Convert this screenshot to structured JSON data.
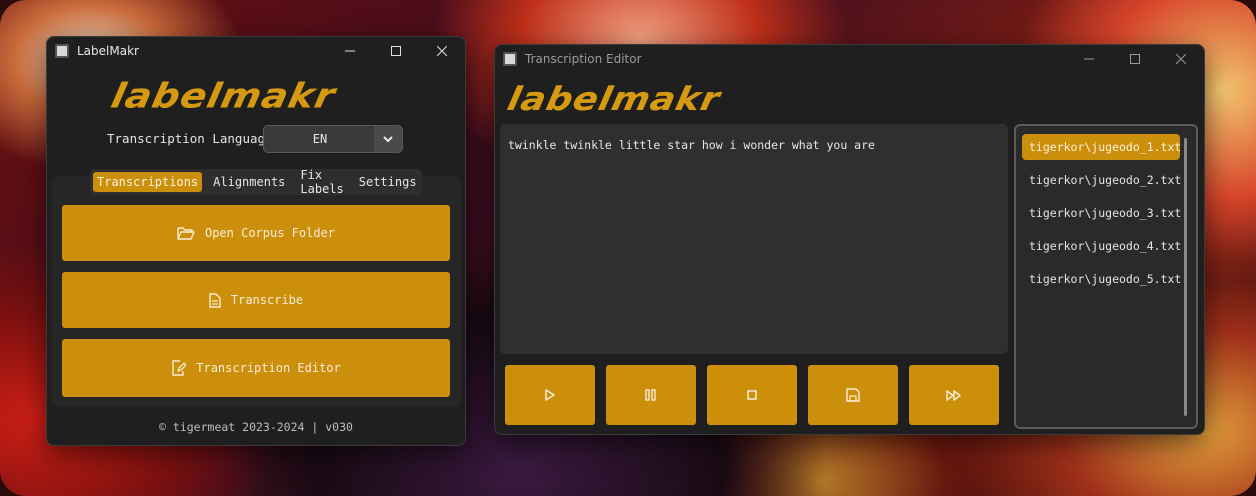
{
  "labelmakr": {
    "window_title": "LabelMakr",
    "logo_text": "labelmakr",
    "language_label": "Transcription Language",
    "language_value": "EN",
    "tabs": [
      "Transcriptions",
      "Alignments",
      "Fix Labels",
      "Settings"
    ],
    "active_tab": "Transcriptions",
    "buttons": {
      "open_corpus": "Open Corpus Folder",
      "transcribe": "Transcribe",
      "editor": "Transcription Editor"
    },
    "footer": "© tigermeat 2023-2024 | v030"
  },
  "editor": {
    "window_title": "Transcription Editor",
    "logo_text": "labelmakr",
    "text_content": "twinkle twinkle little star how i wonder what you are",
    "files": [
      "tigerkor\\jugeodo_1.txt",
      "tigerkor\\jugeodo_2.txt",
      "tigerkor\\jugeodo_3.txt",
      "tigerkor\\jugeodo_4.txt",
      "tigerkor\\jugeodo_5.txt"
    ],
    "selected_file_index": 0,
    "controls": [
      "play-icon",
      "pause-icon",
      "stop-icon",
      "save-icon",
      "fast-forward-icon"
    ]
  },
  "colors": {
    "accent": "#cc8f0c",
    "window_bg": "#1f1f1f",
    "panel_bg": "#2f2f2f"
  }
}
